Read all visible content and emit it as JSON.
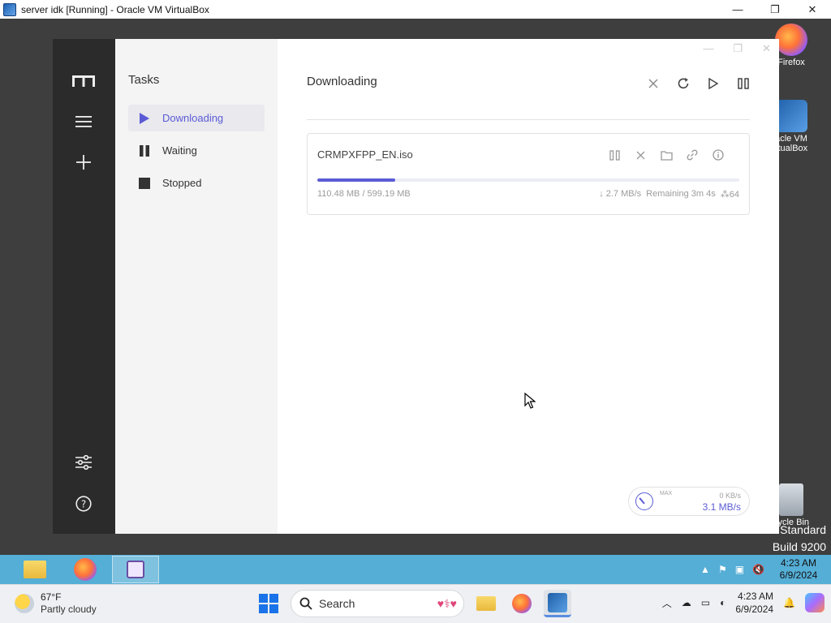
{
  "host": {
    "title": "server idk [Running] - Oracle VM VirtualBox",
    "controls": {
      "minimize": "—",
      "maximize": "❐",
      "close": "✕"
    }
  },
  "desktop": {
    "icons": [
      {
        "label": "Firefox"
      },
      {
        "label": "acle VM\nrtualBox"
      },
      {
        "label": "cycle Bin"
      }
    ],
    "watermark": {
      "line1": "Standard",
      "line2": "Build 9200"
    }
  },
  "app": {
    "rail": {
      "logo": "m",
      "menu": "≡",
      "add": "+",
      "settings": "⚙",
      "help": "?"
    },
    "subnav": {
      "title": "Tasks",
      "items": [
        {
          "label": "Downloading",
          "active": true
        },
        {
          "label": "Waiting",
          "active": false
        },
        {
          "label": "Stopped",
          "active": false
        }
      ]
    },
    "main": {
      "title": "Downloading",
      "task": {
        "name": "CRMPXFPP_EN.iso",
        "progress_percent": 18.4,
        "size_text": "110.48 MB / 599.19 MB",
        "speed_text": "↓ 2.7 MB/s",
        "remaining_text": "Remaining 3m 4s",
        "connections_text": "64"
      },
      "speedometer": {
        "max_label": "MAX",
        "upload": "0 KB/s",
        "download": "3.1 MB/s"
      }
    }
  },
  "guest_taskbar": {
    "clock_time": "4:23 AM",
    "clock_date": "6/9/2024"
  },
  "host_taskbar": {
    "weather_temp": "67°F",
    "weather_desc": "Partly cloudy",
    "search_placeholder": "Search",
    "clock_time": "4:23 AM",
    "clock_date": "6/9/2024"
  }
}
